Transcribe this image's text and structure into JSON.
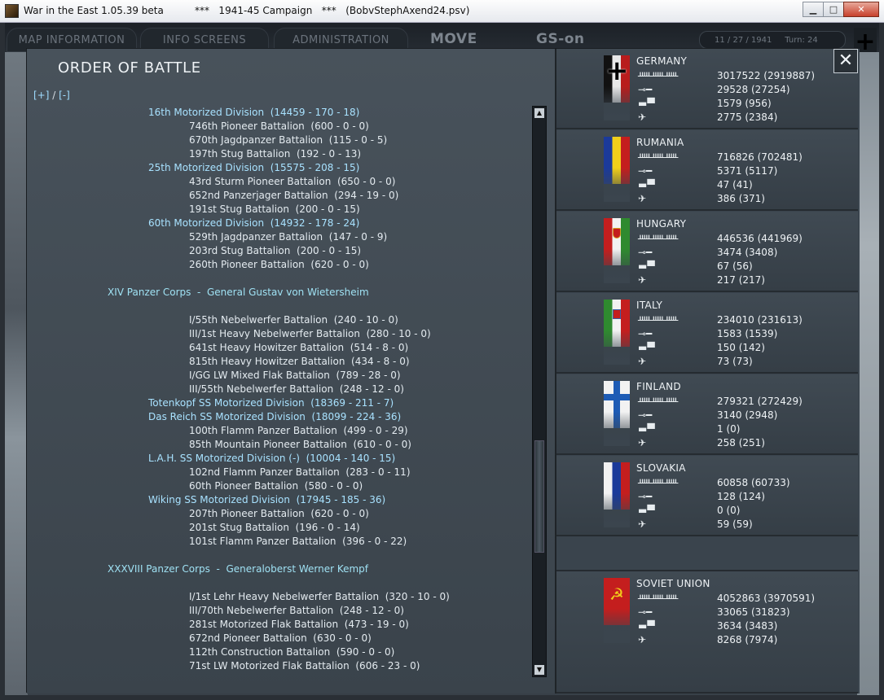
{
  "window": {
    "title": "War in the East 1.05.39 beta          ***   1941-45 Campaign   ***   (BobvStephAxend24.psv)",
    "min_label": "▁",
    "max_label": "□",
    "close_label": "✕"
  },
  "topbar": {
    "tabs": [
      "MAP INFORMATION",
      "INFO SCREENS",
      "ADMINISTRATION"
    ],
    "move_label": "MOVE",
    "gs_label": "GS-on",
    "date": "11 / 27 / 1941",
    "turn": "Turn: 24"
  },
  "panel": {
    "title": "ORDER OF BATTLE",
    "expand_plus": "[+]",
    "expand_sep": " / ",
    "expand_minus": "[-]",
    "close_label": "✕"
  },
  "units": [
    {
      "level": 2,
      "text": "16th Motorized Division  (14459 - 170 - 18)"
    },
    {
      "level": 3,
      "text": "746th Pioneer Battalion  (600 - 0 - 0)"
    },
    {
      "level": 3,
      "text": "670th Jagdpanzer Battalion  (115 - 0 - 5)"
    },
    {
      "level": 3,
      "text": "197th Stug Battalion  (192 - 0 - 13)"
    },
    {
      "level": 2,
      "text": "25th Motorized Division  (15575 - 208 - 15)"
    },
    {
      "level": 3,
      "text": "43rd Sturm Pioneer Battalion  (650 - 0 - 0)"
    },
    {
      "level": 3,
      "text": "652nd Panzerjager Battalion  (294 - 19 - 0)"
    },
    {
      "level": 3,
      "text": "191st Stug Battalion  (200 - 0 - 15)"
    },
    {
      "level": 2,
      "text": "60th Motorized Division  (14932 - 178 - 24)"
    },
    {
      "level": 3,
      "text": "529th Jagdpanzer Battalion  (147 - 0 - 9)"
    },
    {
      "level": 3,
      "text": "203rd Stug Battalion  (200 - 0 - 15)"
    },
    {
      "level": 3,
      "text": "260th Pioneer Battalion  (620 - 0 - 0)"
    },
    {
      "level": 0,
      "text": ""
    },
    {
      "level": 1,
      "text": "XIV Panzer Corps  -  General Gustav von Wietersheim"
    },
    {
      "level": 0,
      "text": ""
    },
    {
      "level": 3,
      "text": "I/55th Nebelwerfer Battalion  (240 - 10 - 0)"
    },
    {
      "level": 3,
      "text": "III/1st Heavy Nebelwerfer Battalion  (280 - 10 - 0)"
    },
    {
      "level": 3,
      "text": "641st Heavy Howitzer Battalion  (514 - 8 - 0)"
    },
    {
      "level": 3,
      "text": "815th Heavy Howitzer Battalion  (434 - 8 - 0)"
    },
    {
      "level": 3,
      "text": "I/GG LW Mixed Flak Battalion  (789 - 28 - 0)"
    },
    {
      "level": 3,
      "text": "III/55th Nebelwerfer Battalion  (248 - 12 - 0)"
    },
    {
      "level": 2,
      "text": "Totenkopf SS Motorized Division  (18369 - 211 - 7)"
    },
    {
      "level": 2,
      "text": "Das Reich SS Motorized Division  (18099 - 224 - 36)"
    },
    {
      "level": 3,
      "text": "100th Flamm Panzer Battalion  (499 - 0 - 29)"
    },
    {
      "level": 3,
      "text": "85th Mountain Pioneer Battalion  (610 - 0 - 0)"
    },
    {
      "level": 2,
      "text": "L.A.H. SS Motorized Division (-)  (10004 - 140 - 15)"
    },
    {
      "level": 3,
      "text": "102nd Flamm Panzer Battalion  (283 - 0 - 11)"
    },
    {
      "level": 3,
      "text": "60th Pioneer Battalion  (580 - 0 - 0)"
    },
    {
      "level": 2,
      "text": "Wiking SS Motorized Division  (17945 - 185 - 36)"
    },
    {
      "level": 3,
      "text": "207th Pioneer Battalion  (620 - 0 - 0)"
    },
    {
      "level": 3,
      "text": "201st Stug Battalion  (196 - 0 - 14)"
    },
    {
      "level": 3,
      "text": "101st Flamm Panzer Battalion  (396 - 0 - 22)"
    },
    {
      "level": 0,
      "text": ""
    },
    {
      "level": 1,
      "text": "XXXVIII Panzer Corps  -  Generaloberst Werner Kempf"
    },
    {
      "level": 0,
      "text": ""
    },
    {
      "level": 3,
      "text": "I/1st Lehr Heavy Nebelwerfer Battalion  (320 - 10 - 0)"
    },
    {
      "level": 3,
      "text": "III/70th Nebelwerfer Battalion  (248 - 12 - 0)"
    },
    {
      "level": 3,
      "text": "281st Motorized Flak Battalion  (473 - 19 - 0)"
    },
    {
      "level": 3,
      "text": "672nd Pioneer Battalion  (630 - 0 - 0)"
    },
    {
      "level": 3,
      "text": "112th Construction Battalion  (590 - 0 - 0)"
    },
    {
      "level": 3,
      "text": "71st LW Motorized Flak Battalion  (606 - 23 - 0)"
    }
  ],
  "nations": [
    {
      "name": "GERMANY",
      "flag": "germany",
      "men": "3017522 (2919887)",
      "guns": "29528 (27254)",
      "afv": "1579 (956)",
      "air": "2775 (2384)"
    },
    {
      "name": "RUMANIA",
      "flag": "rumania",
      "men": "716826 (702481)",
      "guns": "5371 (5117)",
      "afv": "47 (41)",
      "air": "386 (371)"
    },
    {
      "name": "HUNGARY",
      "flag": "hungary",
      "men": "446536 (441969)",
      "guns": "3474 (3408)",
      "afv": "67 (56)",
      "air": "217 (217)"
    },
    {
      "name": "ITALY",
      "flag": "italy",
      "men": "234010 (231613)",
      "guns": "1583 (1539)",
      "afv": "150 (142)",
      "air": "73 (73)"
    },
    {
      "name": "FINLAND",
      "flag": "finland",
      "men": "279321 (272429)",
      "guns": "3140 (2948)",
      "afv": "1 (0)",
      "air": "258 (251)"
    },
    {
      "name": "SLOVAKIA",
      "flag": "slovakia",
      "men": "60858 (60733)",
      "guns": "128 (124)",
      "afv": "0 (0)",
      "air": "59 (59)"
    },
    {
      "name": "SOVIET UNION",
      "flag": "soviet",
      "men": "4052863 (3970591)",
      "guns": "33065 (31823)",
      "afv": "3634 (3483)",
      "air": "8268 (7974)"
    }
  ],
  "icons": {
    "men": "soldiers-icon",
    "guns": "gun-icon",
    "afv": "tank-icon",
    "air": "aircraft-icon"
  }
}
